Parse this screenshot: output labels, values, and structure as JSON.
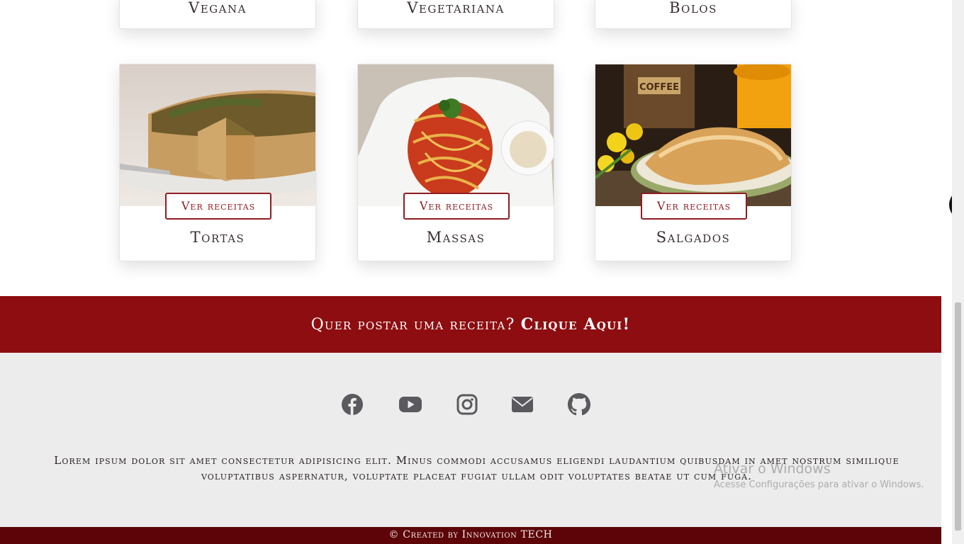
{
  "categories_top": [
    {
      "title": "Vegana"
    },
    {
      "title": "Vegetariana"
    },
    {
      "title": "Bolos"
    }
  ],
  "categories": [
    {
      "title": "Tortas",
      "button": "Ver receitas",
      "image": "quiche-photo"
    },
    {
      "title": "Massas",
      "button": "Ver receitas",
      "image": "spaghetti-photo"
    },
    {
      "title": "Salgados",
      "button": "Ver receitas",
      "image": "pastry-coffee-photo"
    }
  ],
  "banner": {
    "text": "Quer postar uma receita?",
    "link": "Clique Aqui!",
    "color": "#8d0d10"
  },
  "footer": {
    "social": [
      {
        "name": "facebook-icon"
      },
      {
        "name": "youtube-icon"
      },
      {
        "name": "instagram-icon"
      },
      {
        "name": "email-icon"
      },
      {
        "name": "github-icon"
      }
    ],
    "lorem": "Lorem ipsum dolor sit amet consectetur adipisicing elit. Minus commodi accusamus eligendi laudantium quibusdam in amet nostrum similique voluptatibus aspernatur, voluptate placeat fugiat ullam odit voluptates beatae ut cum fuga.",
    "copyright": "© Created by Innovation TECH",
    "copyright_bg": "#5c0407"
  },
  "watermark": {
    "title": "Ativar o Windows",
    "subtitle": "Acesse Configurações para ativar o Windows."
  },
  "side_toggle_icon": "chevron-left-icon"
}
